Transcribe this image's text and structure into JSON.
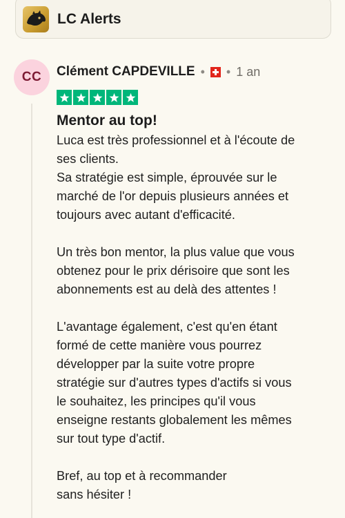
{
  "business": {
    "name": "LC Alerts",
    "logo_icon": "panther-logo-icon"
  },
  "review": {
    "avatar_initials": "CC",
    "author": "Clément CAPDEVILLE",
    "country_flag": "swiss-flag-icon",
    "separator": "•",
    "time_ago": "1 an",
    "rating": 5,
    "star_color": "#00b67a",
    "title": "Mentor au top!",
    "paragraphs": [
      [
        "Luca est très professionnel et à l'écoute de",
        "ses clients.",
        "Sa stratégie est simple, éprouvée sur le",
        "marché de l'or depuis plusieurs années et",
        "toujours avec autant d'efficacité."
      ],
      [
        "Un très bon mentor, la plus value que vous",
        "obtenez pour le prix dérisoire que sont les",
        "abonnements est au delà des attentes !"
      ],
      [
        "L'avantage également, c'est qu'en étant",
        "formé de cette manière vous pourrez",
        "développer par la suite votre propre",
        "stratégie sur d'autres types d'actifs si vous",
        "le souhaitez, les principes qu'il vous",
        "enseigne restants globalement les mêmes",
        "sur tout type d'actif."
      ],
      [
        "Bref, au top et à recommander",
        "sans hésiter !"
      ]
    ]
  }
}
